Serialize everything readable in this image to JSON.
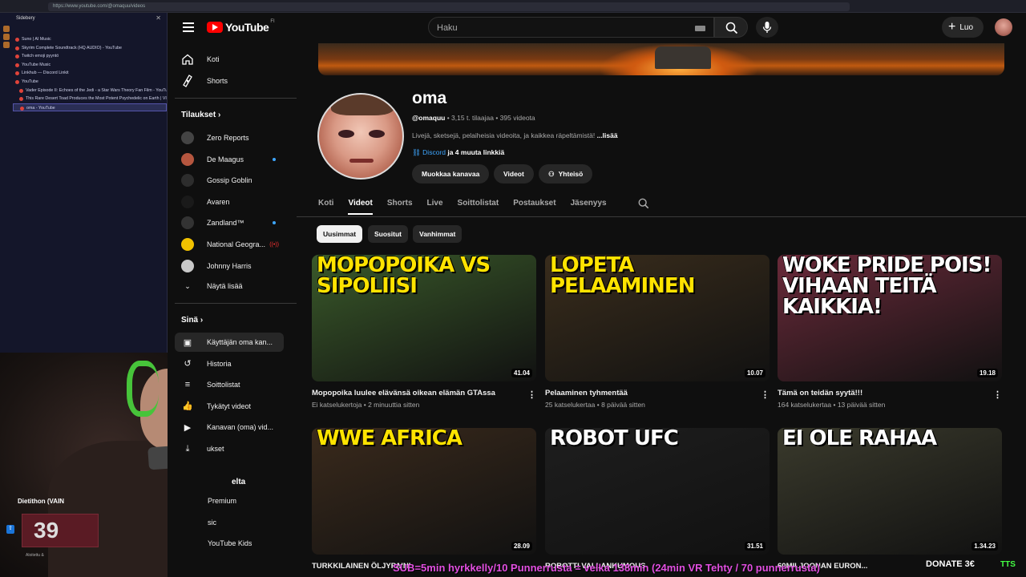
{
  "browser": {
    "url": "https://www.youtube.com/@omaquu/videos"
  },
  "sidebery": {
    "title": "Sidebery",
    "close": "✕",
    "tabs": [
      {
        "label": "Suno | AI Music",
        "sub": false
      },
      {
        "label": "Skyrim Complete Soundtrack (HQ AUDIO) - YouTube",
        "sub": false
      },
      {
        "label": "Twitch emoji pyyntö",
        "sub": false
      },
      {
        "label": "YouTube Music",
        "sub": false
      },
      {
        "label": "Linkhub — Discord Linkit",
        "sub": false
      },
      {
        "label": "YouTube",
        "sub": false
      },
      {
        "label": "Vader Episode II: Echoes of the Jedi - a Star Wars Theory Fan Film - YouTube",
        "sub": true
      },
      {
        "label": "This Rare Desert Toad Produces the Most Potent Psychedelic on Earth | VICE | Il",
        "sub": true
      },
      {
        "label": "oma - YouTube",
        "sub": true,
        "active": true
      }
    ]
  },
  "stream": {
    "donation_label": "Dietithon (VAIN",
    "donation_value": "39",
    "donation_footer": "Aloitettu &",
    "bottom_text": "SUB=5min hyrkkelly/10 Punnerrusta = velka 138min (24min VR Tehty / 70 punnerrusta)",
    "donate_text": "DONATE 3€",
    "tts_text": "TTS"
  },
  "header": {
    "logo_text": "YouTube",
    "logo_sup": "FI",
    "search_placeholder": "Haku",
    "create_label": "Luo"
  },
  "sidebar": {
    "home": "Koti",
    "shorts": "Shorts",
    "subscriptions_title": "Tilaukset",
    "subscriptions": [
      {
        "label": "Zero Reports",
        "color": "#444444",
        "badge": ""
      },
      {
        "label": "De Maagus",
        "color": "#b5563f",
        "badge": "dot"
      },
      {
        "label": "Gossip Goblin",
        "color": "#2d2d2d",
        "badge": ""
      },
      {
        "label": "Avaren",
        "color": "#1a1a1a",
        "badge": ""
      },
      {
        "label": "Zandland™",
        "color": "#333333",
        "badge": "dot"
      },
      {
        "label": "National Geogra...",
        "color": "#f2c200",
        "badge": "live"
      },
      {
        "label": "Johnny Harris",
        "color": "#c9c9c9",
        "badge": ""
      }
    ],
    "show_more": "Näytä lisää",
    "you_title": "Sinä",
    "you_items": [
      {
        "label": "Käyttäjän oma kan...",
        "icon": "channel-icon",
        "active": true
      },
      {
        "label": "Historia",
        "icon": "history-icon"
      },
      {
        "label": "Soittolistat",
        "icon": "playlists-icon"
      },
      {
        "label": "Tykätyt videot",
        "icon": "like-icon"
      },
      {
        "label": "Kanavan (oma) vid...",
        "icon": "videos-icon"
      },
      {
        "label": "ukset",
        "icon": "downloads-icon"
      }
    ],
    "more_title": "elta",
    "more_items": [
      "Premium",
      "sic",
      "YouTube Kids"
    ]
  },
  "channel": {
    "name": "oma",
    "handle": "@omaquu",
    "subscribers": "• 3,15 t. tilaajaa • 395 videota",
    "description": "Livejä, sketsejä, pelaiheisia videoita, ja kaikkea räpeltämistä!",
    "more_label": "...lisää",
    "link_label": "Discord",
    "other_links": "ja 4 muuta linkkiä",
    "buttons": {
      "customize": "Muokkaa kanavaa",
      "videos": "Videot",
      "community": "Yhteisö"
    },
    "tabs": [
      "Koti",
      "Videot",
      "Shorts",
      "Live",
      "Soittolistat",
      "Postaukset",
      "Jäsenyys"
    ],
    "active_tab": "Videot",
    "chips": [
      "Uusimmat",
      "Suositut",
      "Vanhimmat"
    ]
  },
  "videos": [
    {
      "thumb_text": "MOPOPOIKA VS SIPOLIISI",
      "title": "Mopopoika luulee elävänsä oikean elämän GTAssa",
      "views": "Ei katselukertoja",
      "age": "2 minuuttia sitten",
      "duration": "41.04",
      "bg": "#3a5a2a",
      "text_color": "#ffe300"
    },
    {
      "thumb_text": "LOPETA PELAAMINEN",
      "title": "Pelaaminen tyhmentää",
      "views": "25 katselukertaa",
      "age": "8 päivää sitten",
      "duration": "10.07",
      "bg": "#3a2d1c",
      "text_color": "#ffe300"
    },
    {
      "thumb_text": "WOKE PRIDE POIS! VIHAAN TEITÄ KAIKKIA!",
      "title": "Tämä on teidän syytä!!!",
      "views": "164 katselukertaa",
      "age": "13 päivää sitten",
      "duration": "19.18",
      "bg": "#6a2a3a",
      "text_color": "#ffffff"
    },
    {
      "thumb_text": "WWE AFRICA",
      "title": "TURKKILAINEN ÖLJYPAINI",
      "views": "",
      "age": "",
      "duration": "28.09",
      "bg": "#3a2a1c",
      "text_color": "#ffe300"
    },
    {
      "thumb_text": "ROBOT UFC",
      "title": "ROBOTTI VALLANKUMOUS",
      "views": "",
      "age": "",
      "duration": "31.51",
      "bg": "#1e1e1e",
      "text_color": "#ffffff"
    },
    {
      "thumb_text": "EI OLE RAHAA",
      "title": "60MILJOONAN EURON...",
      "views": "",
      "age": "",
      "duration": "1.34.23",
      "bg": "#3a3a2c",
      "text_color": "#ffffff"
    }
  ]
}
